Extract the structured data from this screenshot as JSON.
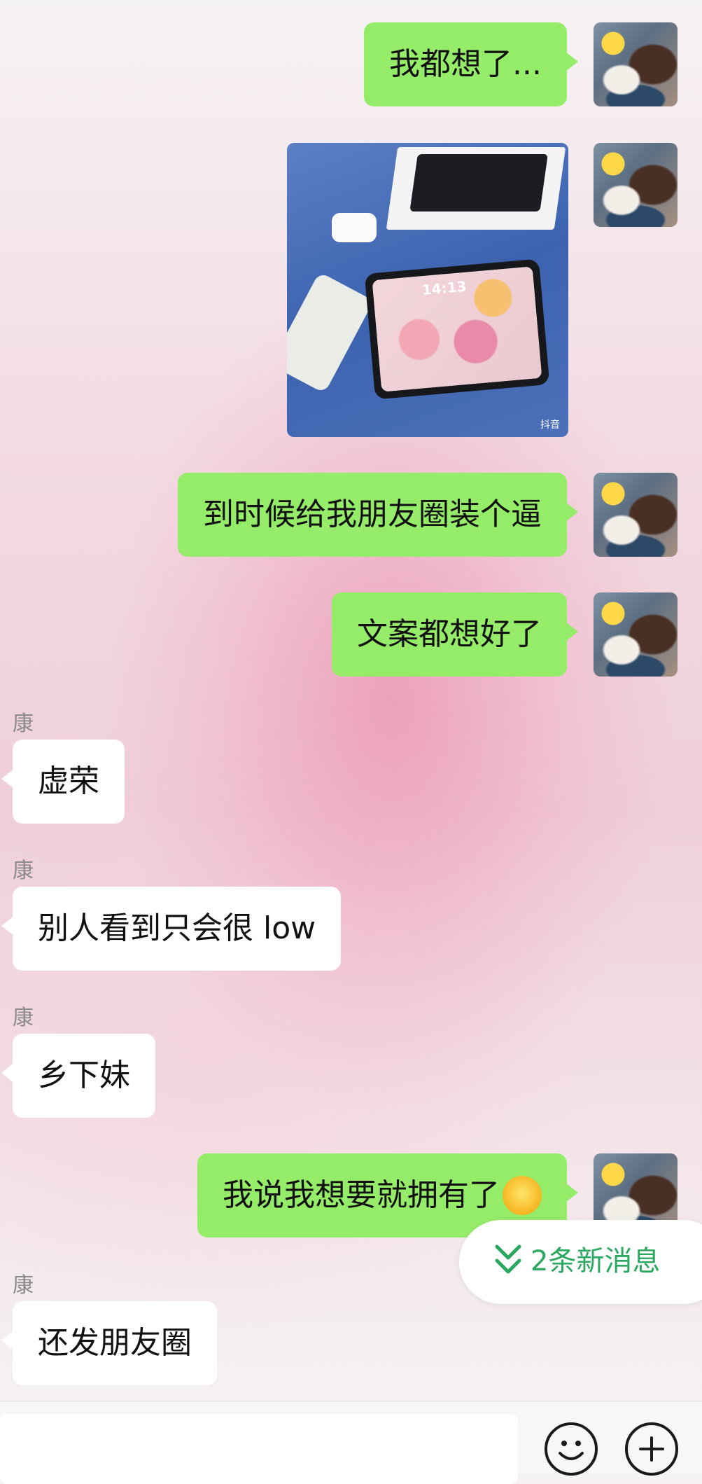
{
  "messages": [
    {
      "side": "me",
      "text": "我都想了..."
    },
    {
      "side": "me",
      "type": "image",
      "image_caption": "抖音",
      "image_clock": "14:13"
    },
    {
      "side": "me",
      "text": "到时候给我朋友圈装个逼"
    },
    {
      "side": "me",
      "text": "文案都想好了"
    },
    {
      "side": "other",
      "sender": "康",
      "text": "虚荣"
    },
    {
      "side": "other",
      "sender": "康",
      "text": "别人看到只会很 low"
    },
    {
      "side": "other",
      "sender": "康",
      "text": "乡下妹"
    },
    {
      "side": "me",
      "text": "我说我想要就拥有了",
      "emoji": "grinning-face-emoji"
    },
    {
      "side": "other",
      "sender": "康",
      "text": "还发朋友圈"
    }
  ],
  "new_messages": {
    "label": "2条新消息",
    "icon": "double-chevron-down-icon"
  },
  "input": {
    "value": "",
    "icons": [
      "emoji-icon",
      "plus-icon"
    ]
  },
  "colors": {
    "me_bubble": "#95ec69",
    "other_bubble": "#ffffff",
    "new_msg_text": "#2aa860"
  }
}
